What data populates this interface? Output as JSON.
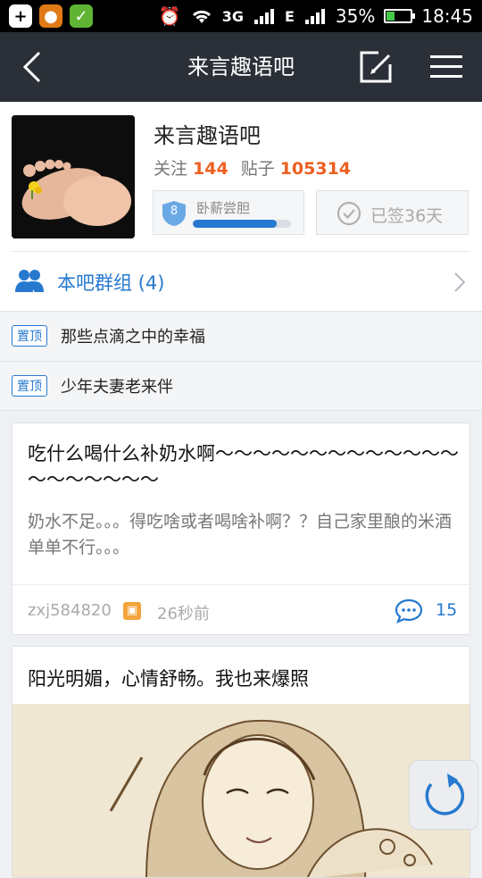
{
  "status_bar": {
    "network": "3G",
    "data_type": "E",
    "battery_percent": "35%",
    "battery_level": 0.35,
    "time": "18:45"
  },
  "nav": {
    "title": "来言趣语吧",
    "back_icon": "chevron-left-icon",
    "edit_icon": "compose-icon",
    "menu_icon": "hamburger-menu-icon"
  },
  "forum": {
    "name": "来言趣语吧",
    "follow_label": "关注",
    "follow_count": "144",
    "posts_label": "贴子",
    "posts_count": "105314",
    "level": "8",
    "level_name": "卧薪尝胆",
    "level_progress": 0.85,
    "signed_label": "已签36天",
    "group_label": "本吧群组 (4)"
  },
  "pinned": [
    {
      "tag": "置顶",
      "title": "那些点滴之中的幸福"
    },
    {
      "tag": "置顶",
      "title": "少年夫妻老来伴"
    }
  ],
  "posts": [
    {
      "title": "吃什么喝什么补奶水啊～～～～～～～～～～～～～～～～～～～～",
      "body": "奶水不足。。。得吃啥或者喝啥补啊？？自己家里酿的米酒单单不行。。。",
      "author": "zxj584820",
      "time": "26秒前",
      "comments": "15"
    },
    {
      "title": "阳光明媚，心情舒畅。我也来爆照"
    }
  ],
  "colors": {
    "nav_bg": "#2b3038",
    "accent_blue": "#2679cf",
    "accent_orange": "#ee5e1f"
  }
}
